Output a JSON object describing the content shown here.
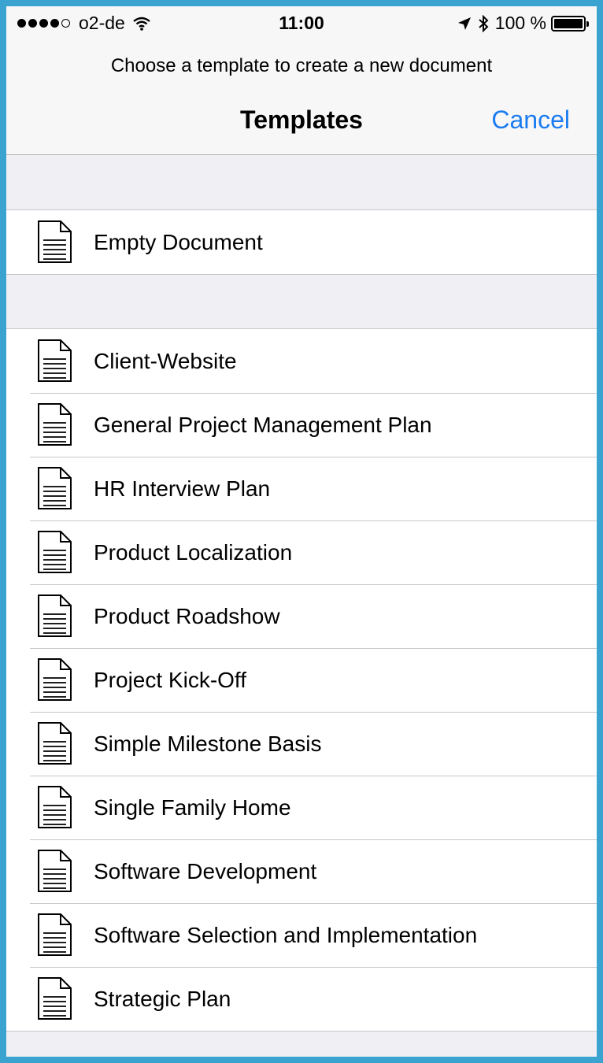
{
  "status_bar": {
    "carrier": "o2-de",
    "time": "11:00",
    "battery": "100 %",
    "signal_bars_filled": 4,
    "signal_bars_total": 5
  },
  "nav": {
    "prompt": "Choose a template to create a new document",
    "title": "Templates",
    "cancel_label": "Cancel"
  },
  "colors": {
    "accent": "#1a7cf0",
    "frame": "#3aa3cf",
    "group_background": "#efeff4"
  },
  "sections": [
    {
      "items": [
        {
          "label": "Empty Document",
          "icon": "document-icon"
        }
      ]
    },
    {
      "items": [
        {
          "label": "Client-Website",
          "icon": "document-icon"
        },
        {
          "label": "General Project Management Plan",
          "icon": "document-icon"
        },
        {
          "label": "HR Interview Plan",
          "icon": "document-icon"
        },
        {
          "label": "Product Localization",
          "icon": "document-icon"
        },
        {
          "label": "Product Roadshow",
          "icon": "document-icon"
        },
        {
          "label": "Project Kick-Off",
          "icon": "document-icon"
        },
        {
          "label": "Simple Milestone Basis",
          "icon": "document-icon"
        },
        {
          "label": "Single Family Home",
          "icon": "document-icon"
        },
        {
          "label": "Software Development",
          "icon": "document-icon"
        },
        {
          "label": "Software Selection and Implementation",
          "icon": "document-icon"
        },
        {
          "label": "Strategic Plan",
          "icon": "document-icon"
        }
      ]
    }
  ]
}
